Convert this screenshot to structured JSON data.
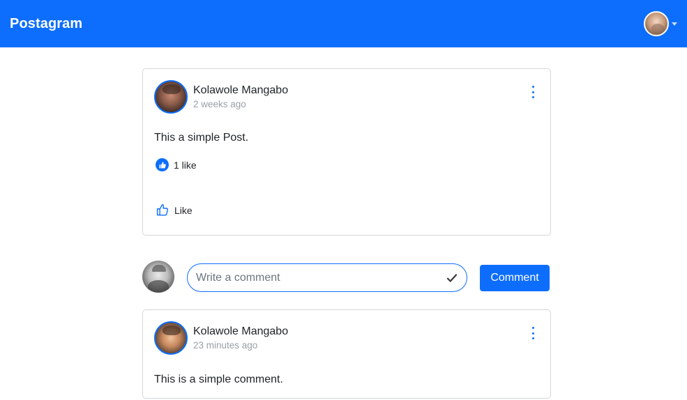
{
  "navbar": {
    "brand": "Postagram",
    "user_avatar_icon": "user-avatar",
    "dropdown_icon": "caret-down-icon"
  },
  "post": {
    "author": "Kolawole Mangabo",
    "time": "2 weeks ago",
    "body": "This a simple Post.",
    "likes_text": "1 like",
    "like_label": "Like",
    "menu_icon": "kebab-menu-icon"
  },
  "comment_form": {
    "placeholder": "Write a comment",
    "submit_icon": "check-icon",
    "button_label": "Comment"
  },
  "comments": [
    {
      "author": "Kolawole Mangabo",
      "time": "23 minutes ago",
      "body": "This is a simple comment.",
      "menu_icon": "kebab-menu-icon"
    }
  ],
  "colors": {
    "primary": "#0d6efd",
    "muted_text": "#9aa0a6",
    "border": "#d3d6da"
  }
}
